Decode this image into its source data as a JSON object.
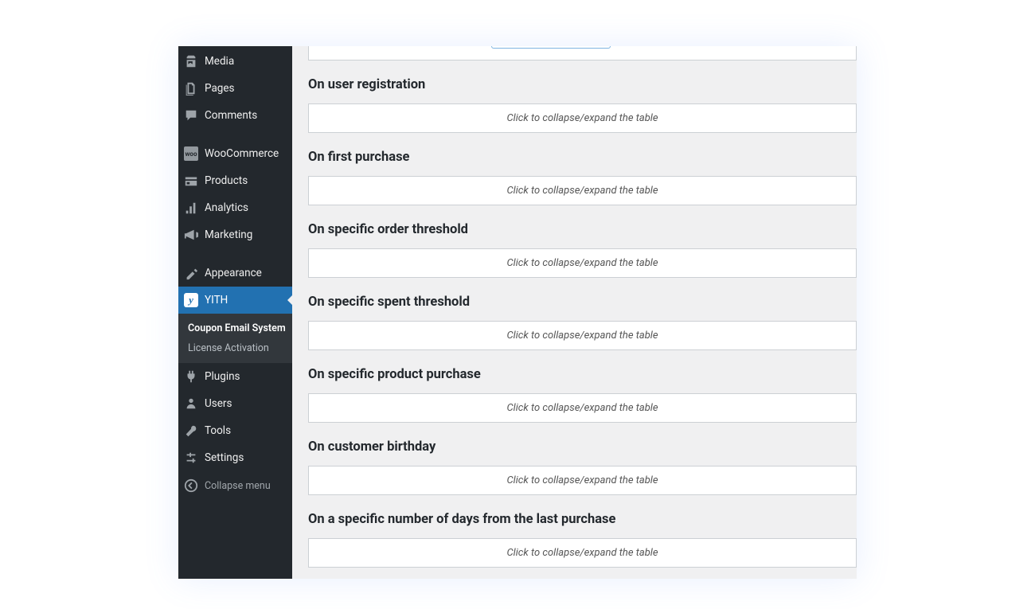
{
  "sidebar": {
    "items": [
      {
        "key": "media",
        "label": "Media"
      },
      {
        "key": "pages",
        "label": "Pages"
      },
      {
        "key": "comments",
        "label": "Comments"
      },
      {
        "key": "woocommerce",
        "label": "WooCommerce"
      },
      {
        "key": "products",
        "label": "Products"
      },
      {
        "key": "analytics",
        "label": "Analytics"
      },
      {
        "key": "marketing",
        "label": "Marketing"
      },
      {
        "key": "appearance",
        "label": "Appearance"
      },
      {
        "key": "yith",
        "label": "YITH"
      },
      {
        "key": "plugins",
        "label": "Plugins"
      },
      {
        "key": "users",
        "label": "Users"
      },
      {
        "key": "tools",
        "label": "Tools"
      },
      {
        "key": "settings",
        "label": "Settings"
      }
    ],
    "submenu": {
      "coupon_label": "Coupon Email System",
      "license_label": "License Activation"
    },
    "collapse_label": "Collapse menu"
  },
  "content": {
    "sections": [
      {
        "title": "On user registration"
      },
      {
        "title": "On first purchase"
      },
      {
        "title": "On specific order threshold"
      },
      {
        "title": "On specific spent threshold"
      },
      {
        "title": "On specific product purchase"
      },
      {
        "title": "On customer birthday"
      },
      {
        "title": "On a specific number of days from the last purchase"
      }
    ],
    "collapse_text": "Click to collapse/expand the table"
  }
}
